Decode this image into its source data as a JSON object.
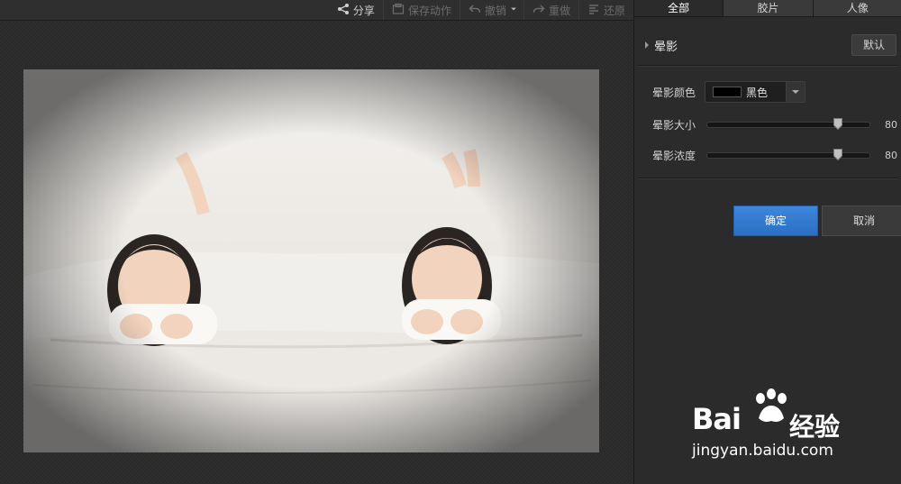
{
  "toolbar": {
    "share": "分享",
    "save_action": "保存动作",
    "undo": "撤销",
    "redo": "重做",
    "restore": "还原"
  },
  "tabs": [
    {
      "label": "全部",
      "active": true
    },
    {
      "label": "胶片",
      "active": false
    },
    {
      "label": "人像",
      "active": false
    }
  ],
  "vignette": {
    "title": "晕影",
    "default_label": "默认",
    "color_label": "晕影颜色",
    "color_value": "黑色",
    "color_hex": "#000000",
    "size_label": "晕影大小",
    "size_value": 80,
    "size_display": "80",
    "density_label": "晕影浓度",
    "density_value": 80,
    "density_display": "80"
  },
  "actions": {
    "confirm": "确定",
    "cancel": "取消"
  },
  "watermark": {
    "brand": "Bai",
    "brand_cn": "经验",
    "url": "jingyan.baidu.com"
  },
  "colors": {
    "accent": "#2f74c8",
    "panel_bg": "#2b2b2b"
  }
}
